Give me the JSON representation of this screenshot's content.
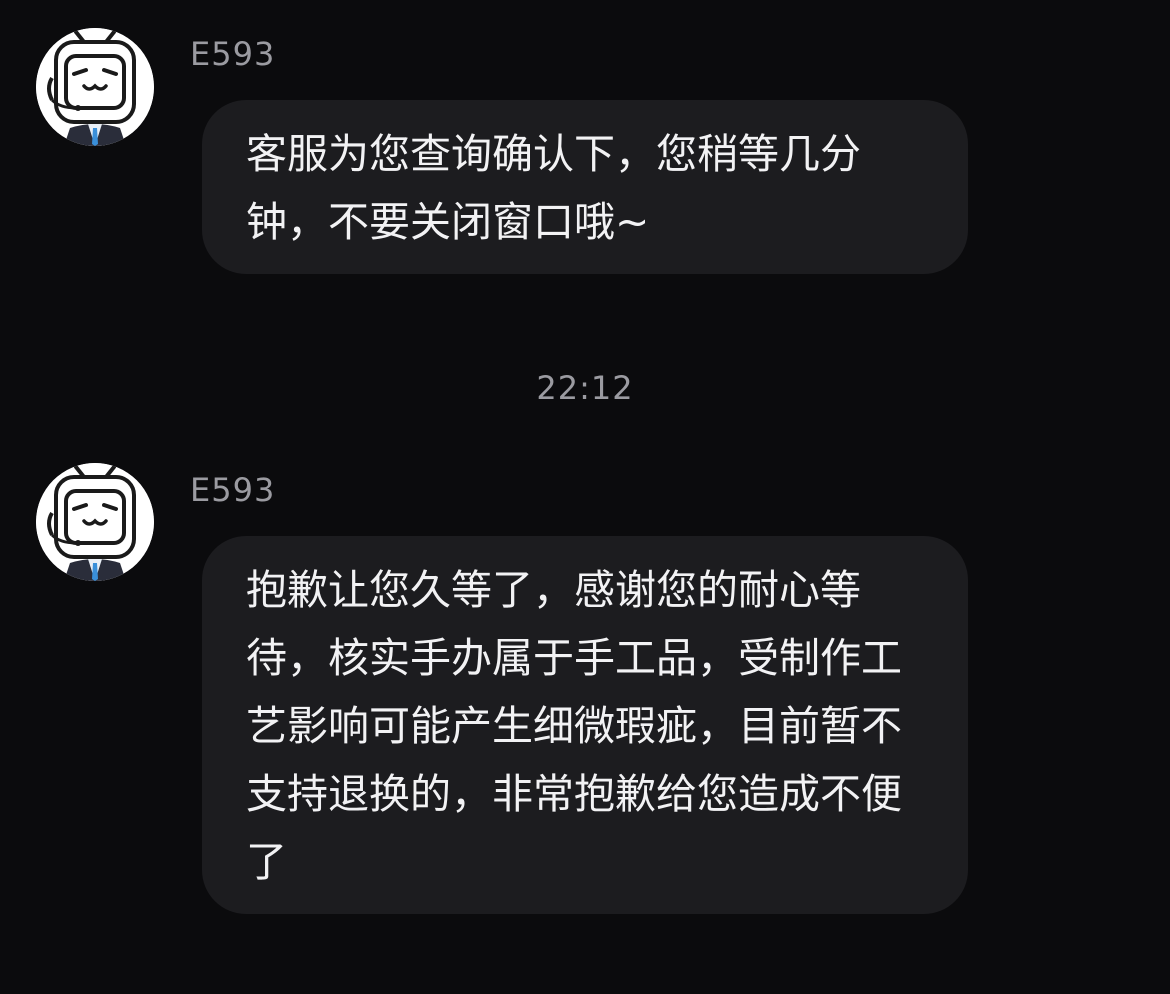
{
  "messages": [
    {
      "sender": "E593",
      "text": "客服为您查询确认下，您稍等几分钟，不要关闭窗口哦~"
    },
    {
      "sender": "E593",
      "text": "抱歉让您久等了，感谢您的耐心等待，核实手办属于手工品，受制作工艺影响可能产生细微瑕疵，目前暂不支持退换的，非常抱歉给您造成不便了"
    }
  ],
  "timestamp": "22:12",
  "icons": {
    "avatar": "bilibili-tv-robot-agent-icon"
  }
}
